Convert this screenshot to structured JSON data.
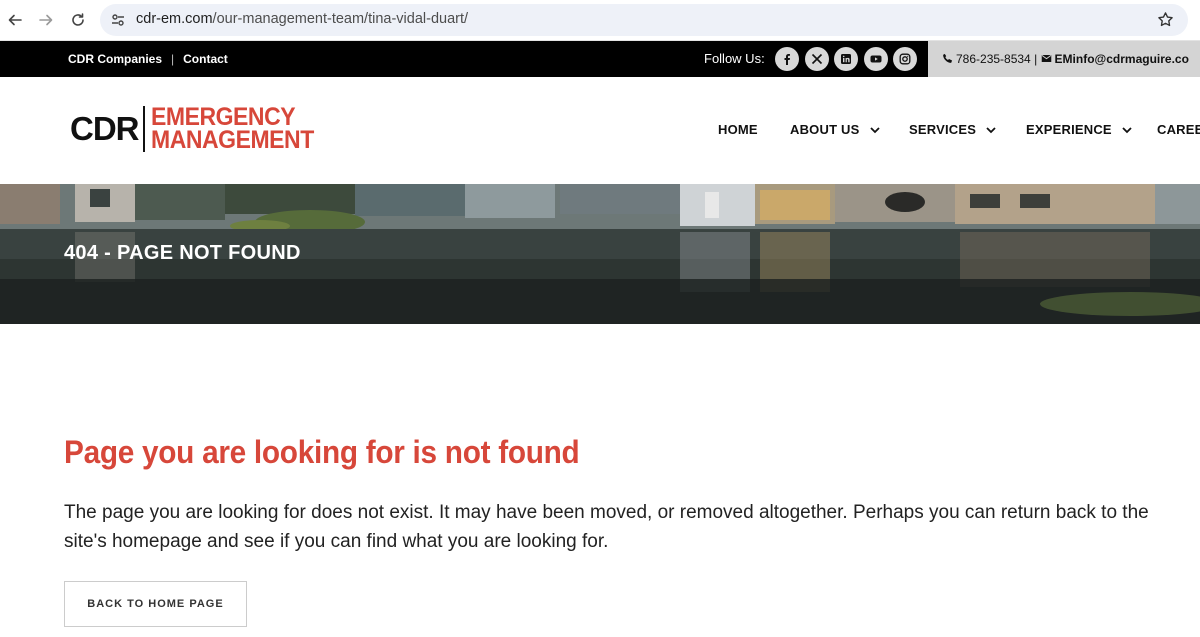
{
  "browser": {
    "url_domain": "cdr-em.com",
    "url_path": "/our-management-team/tina-vidal-duart/",
    "back_icon": "arrow-left-icon",
    "forward_icon": "arrow-right-icon",
    "reload_icon": "reload-icon",
    "star_icon": "star-icon"
  },
  "utility_bar": {
    "links": [
      "CDR Companies",
      "Contact"
    ],
    "separator": "|",
    "follow_label": "Follow Us:",
    "social_icons": [
      "facebook-icon",
      "x-icon",
      "linkedin-icon",
      "youtube-icon",
      "instagram-icon"
    ],
    "phone": "786-235-8534",
    "divider": "|",
    "email": "EMinfo@cdrmaguire.co"
  },
  "header": {
    "logo": {
      "brand": "CDR",
      "line1": "EMERGENCY",
      "line2": "MANAGEMENT"
    },
    "nav": [
      {
        "label": "HOME",
        "has_dropdown": false
      },
      {
        "label": "ABOUT US",
        "has_dropdown": true
      },
      {
        "label": "SERVICES",
        "has_dropdown": true
      },
      {
        "label": "EXPERIENCE",
        "has_dropdown": true
      },
      {
        "label": "CAREER",
        "has_dropdown": false
      }
    ]
  },
  "hero": {
    "title": "404 - PAGE NOT FOUND"
  },
  "content": {
    "heading": "Page you are looking for is not found",
    "body": "The page you are looking for does not exist. It may have been moved, or removed altogether. Perhaps you can return back to the site's homepage and see if you can find what you are looking for.",
    "button_label": "BACK TO HOME PAGE"
  },
  "colors": {
    "accent_red": "#d7473a",
    "top_bar": "#000000",
    "contact_box": "#d4d4d4"
  }
}
